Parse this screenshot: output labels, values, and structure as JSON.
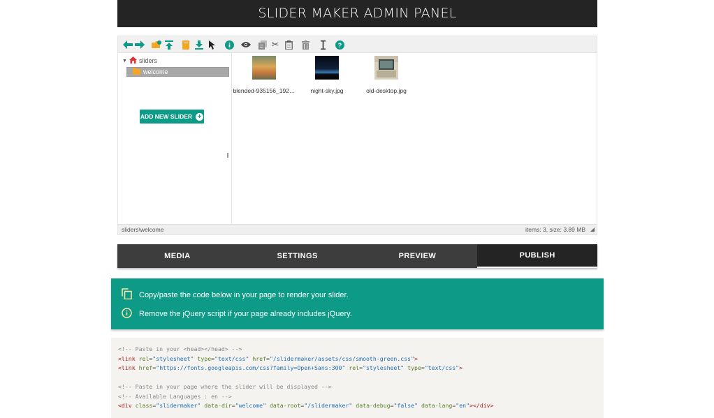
{
  "header": {
    "title": "SLIDER MAKER ADMIN PANEL"
  },
  "toolbar": {
    "buttons": [
      {
        "name": "back-icon",
        "glyph": "⬅",
        "color": "#0d9b87"
      },
      {
        "name": "forward-icon",
        "glyph": "➡",
        "color": "#0d9b87"
      },
      {
        "name": "new-folder-icon",
        "glyph": "📁",
        "color": "#f6a623"
      },
      {
        "name": "upload-icon",
        "glyph": "⤒",
        "color": "#0d9b87"
      },
      {
        "name": "new-file-icon",
        "glyph": "▮",
        "color": "#f6a623"
      },
      {
        "name": "download-icon",
        "glyph": "⤓",
        "color": "#0d9b87"
      },
      {
        "name": "select-cursor-icon",
        "glyph": "➤",
        "color": "#222"
      },
      {
        "name": "info-icon",
        "glyph": "i",
        "color": "#0d9b87"
      },
      {
        "name": "preview-eye-icon",
        "glyph": "👁",
        "color": "#444"
      },
      {
        "name": "copy-icon",
        "glyph": "▤",
        "color": "#888"
      },
      {
        "name": "cut-icon",
        "glyph": "✂",
        "color": "#666"
      },
      {
        "name": "paste-icon",
        "glyph": "📋",
        "color": "#666"
      },
      {
        "name": "delete-icon",
        "glyph": "🗑",
        "color": "#777"
      },
      {
        "name": "rename-icon",
        "glyph": "I",
        "color": "#333"
      },
      {
        "name": "help-icon",
        "glyph": "?",
        "color": "#0d9b87"
      }
    ]
  },
  "tree": {
    "root_label": "sliders",
    "selected_label": "welcome",
    "add_button_label": "ADD NEW SLIDER"
  },
  "files": [
    {
      "name": "blended-935156_192…"
    },
    {
      "name": "night-sky.jpg"
    },
    {
      "name": "old-desktop.jpg"
    }
  ],
  "statusbar": {
    "path": "sliders\\welcome",
    "summary": "items: 3, size: 3.89 MB"
  },
  "tabs": [
    {
      "label": "MEDIA"
    },
    {
      "label": "SETTINGS"
    },
    {
      "label": "PREVIEW"
    },
    {
      "label": "PUBLISH"
    }
  ],
  "notice": {
    "line1": "Copy/paste the code below in your page to render your slider.",
    "line2": "Remove the jQuery script if your page already includes jQuery."
  },
  "code": {
    "comment_head": "<!-- Paste in your <head></head> -->",
    "link1_href": "/slidermaker/assets/css/smooth-green.css",
    "link2_href": "https://fonts.googleapis.com/css?family=Open+Sans:300",
    "comment_page": "<!-- Paste in your page where the slider will be displayed -->",
    "comment_lang": "<!-- Available Languages : en -->",
    "div_class": "slidermaker",
    "div_dir": "welcome",
    "div_root": "/slidermaker",
    "div_debug": "false",
    "div_lang": "en"
  },
  "colors": {
    "accent": "#0d9b87",
    "header_bg": "#242424",
    "tab_bg": "#3d3d3d"
  }
}
